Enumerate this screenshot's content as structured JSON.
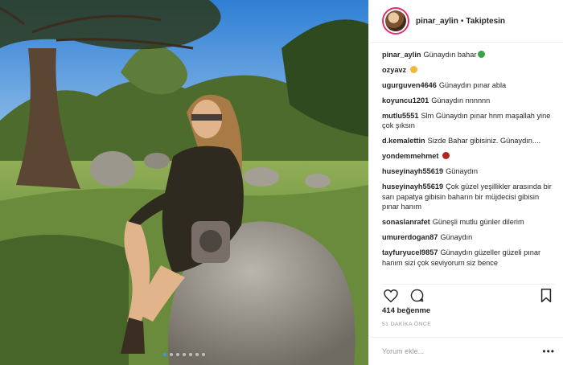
{
  "post": {
    "username": "pinar_aylin",
    "follow_status": "Takiptesin",
    "separator": "•"
  },
  "comments": [
    {
      "user": "pinar_aylin",
      "text": "Günaydın bahar",
      "emoji": "shamrock-emoji"
    },
    {
      "user": "ozyavz",
      "text": "",
      "emoji": "thumbs-up-emoji"
    },
    {
      "user": "ugurguven4646",
      "text": "Günaydın pınar abla"
    },
    {
      "user": "koyuncu1201",
      "text": "Günaydın nnnnnn"
    },
    {
      "user": "mutlu5551",
      "text": "Slm Günaydın pınar hnm maşallah yine çok şıksın"
    },
    {
      "user": "d.kemalettin",
      "text": "Sizde Bahar gibisiniz. Günaydın...."
    },
    {
      "user": "yondemmehmet",
      "text": "",
      "emoji": "devil-emoji"
    },
    {
      "user": "huseyinayh55619",
      "text": "Günaydın"
    },
    {
      "user": "huseyinayh55619",
      "text": "Çok güzel yeşillikler arasında bir sarı papatya gibisin baharın bir müjdecisi gibisin pınar hanım"
    },
    {
      "user": "sonaslanrafet",
      "text": "Güneşli mutlu günler dilerim"
    },
    {
      "user": "umurerdogan87",
      "text": "Günaydın"
    },
    {
      "user": "tayfuryucel9857",
      "text": "Günaydın güzeller güzeli pınar hanım sizi çok seviyorum siz bence"
    }
  ],
  "actions": {
    "likes": "414 beğenme",
    "time": "51 DAKİKA ÖNCE"
  },
  "add_comment": {
    "placeholder": "Yorum ekle...",
    "more": "•••"
  },
  "carousel": {
    "count": 7,
    "active_index": 0,
    "active_color": "#3897f0"
  },
  "colors": {
    "text": "#262626",
    "muted": "#999999",
    "border": "#efefef",
    "story_ring": "#e1306c"
  }
}
